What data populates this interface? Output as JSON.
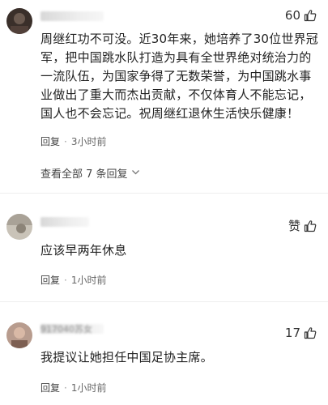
{
  "comments": [
    {
      "like_count": "60",
      "text": "周继红功不可没。近30年来，她培养了30位世界冠军，把中国跳水队打造为具有全世界绝对统治力的一流队伍，为国家争得了无数荣誉，为中国跳水事业做出了重大而杰出贡献，不仅体育人不能忘记，国人也不会忘记。祝周继红退休生活快乐健康！",
      "reply_label": "回复",
      "time": "3小时前",
      "view_replies": "查看全部 7 条回复"
    },
    {
      "like_label": "赞",
      "text": "应该早两年休息",
      "reply_label": "回复",
      "time": "1小时前"
    },
    {
      "username": "917040苏女",
      "like_count": "17",
      "text": "我提议让她担任中国足协主席。",
      "reply_label": "回复",
      "time": "1小时前"
    }
  ],
  "colors": {
    "text": "#222222",
    "meta": "#666666",
    "background": "#ffffff"
  },
  "icons": {
    "like": "thumbs-up-icon",
    "expand": "chevron-down-icon"
  }
}
